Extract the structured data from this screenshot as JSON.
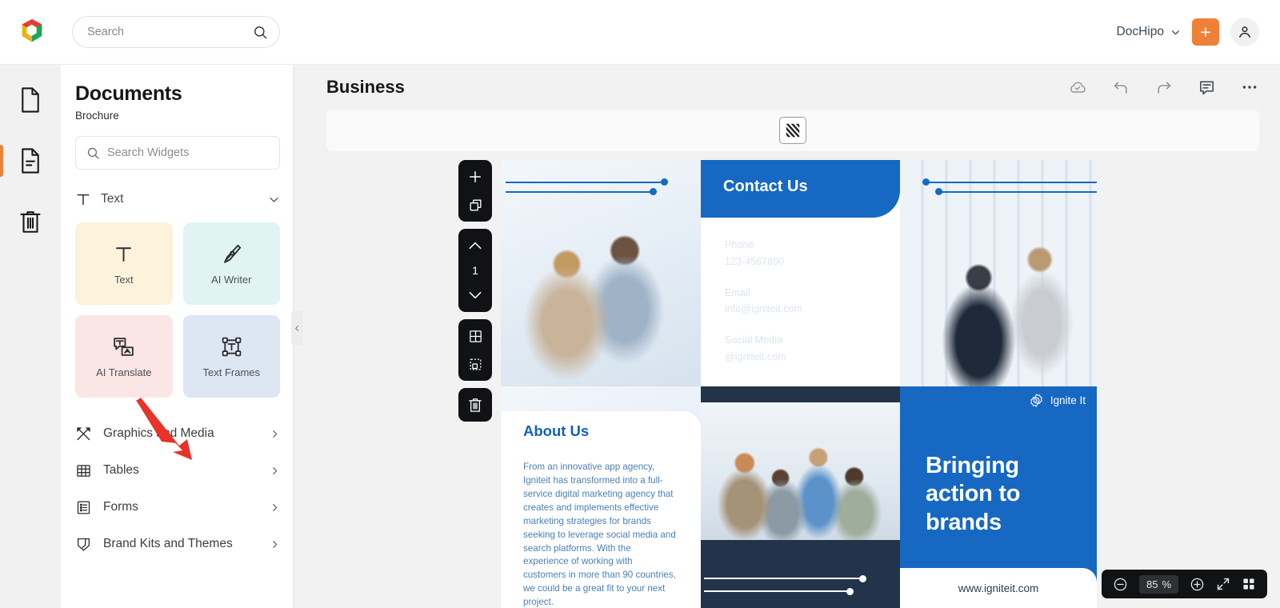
{
  "header": {
    "logo_icon": "dochipo-logo-icon",
    "search": {
      "placeholder": "Search",
      "value": "",
      "icon": "search-icon"
    },
    "workspace": {
      "label": "DocHipo",
      "icon": "chevron-down-icon"
    },
    "create_button": {
      "label": "+",
      "icon": "plus-icon",
      "color": "#ef8037"
    },
    "account_button": {
      "icon": "user-icon"
    }
  },
  "rail": {
    "items": [
      {
        "name": "pages",
        "icon": "page-icon",
        "active": false
      },
      {
        "name": "documents",
        "icon": "document-lines-icon",
        "active": true
      },
      {
        "name": "trash",
        "icon": "trash-icon",
        "active": false
      }
    ]
  },
  "panel": {
    "title": "Documents",
    "subtitle": "Brochure",
    "search": {
      "placeholder": "Search Widgets",
      "value": "",
      "icon": "search-icon"
    },
    "group": {
      "label": "Text",
      "icon": "text-t-icon",
      "chevron": "chevron-down-icon",
      "expanded": true
    },
    "cards": [
      {
        "label": "Text",
        "icon": "text-t-icon",
        "bg": "#fdf3dd"
      },
      {
        "label": "AI Writer",
        "icon": "pen-nib-icon",
        "bg": "#e2f4f2"
      },
      {
        "label": "AI Translate",
        "icon": "translate-icon",
        "bg": "#fbe6e6"
      },
      {
        "label": "Text Frames",
        "icon": "text-frame-icon",
        "bg": "#dde6f3"
      }
    ],
    "categories": [
      {
        "label": "Graphics and Media",
        "icon": "graphics-media-icon",
        "chevron": "chevron-right-icon"
      },
      {
        "label": "Tables",
        "icon": "table-icon",
        "chevron": "chevron-right-icon"
      },
      {
        "label": "Forms",
        "icon": "form-icon",
        "chevron": "chevron-right-icon"
      },
      {
        "label": "Brand Kits and Themes",
        "icon": "brand-kit-icon",
        "chevron": "chevron-right-icon"
      }
    ],
    "collapse": {
      "icon": "chevron-left-icon"
    }
  },
  "editor": {
    "doc_title": "Business",
    "tools": [
      {
        "name": "cloud-saved",
        "icon": "cloud-check-icon"
      },
      {
        "name": "undo",
        "icon": "undo-arrow-icon"
      },
      {
        "name": "redo",
        "icon": "redo-arrow-icon"
      },
      {
        "name": "comments",
        "icon": "comment-icon"
      },
      {
        "name": "more-options",
        "icon": "ellipsis-icon"
      }
    ],
    "pagestrip": {
      "thumb_icon": "page-thumbnail-icon"
    },
    "floatbar": {
      "add_page_icon": "plus-icon",
      "duplicate_page_icon": "duplicate-icon",
      "page_up_icon": "chevron-up-icon",
      "page_number": "1",
      "page_down_icon": "chevron-down-icon",
      "grid_icon": "grid-icon",
      "selection_icon": "selection-icon",
      "delete_icon": "trash-icon"
    },
    "zoom": {
      "minus_icon": "minus-circle-icon",
      "value": "85",
      "unit": "%",
      "plus_icon": "plus-circle-icon",
      "fullscreen_icon": "expand-icon",
      "grid_view_icon": "grid-view-icon"
    }
  },
  "brochure": {
    "contact": {
      "title": "Contact Us",
      "entries": [
        {
          "label": "Phone",
          "value": "123-4567890"
        },
        {
          "label": "Email",
          "value": "info@igniteit.com"
        },
        {
          "label": "Social Media",
          "value": "@igniteit.com"
        }
      ]
    },
    "about": {
      "title": "About Us",
      "body": "From an innovative app agency, Igniteit has transformed into a full-service digital marketing agency that creates and implements effective marketing strategies for brands seeking to leverage social media and search platforms. With the experience of working with customers in more than 90 countries, we could be a great fit to your next project."
    },
    "brand": {
      "name": "Ignite It",
      "icon": "ignite-badge-icon"
    },
    "cta": {
      "headline": "Bringing\naction to\nbrands"
    },
    "website": "www.igniteit.com",
    "accent_color": "#1668c3",
    "dark_color": "#23334a"
  },
  "annotation": {
    "arrow": "red-pointer-arrow",
    "color": "#e8322a",
    "points_to": "AI Translate"
  }
}
